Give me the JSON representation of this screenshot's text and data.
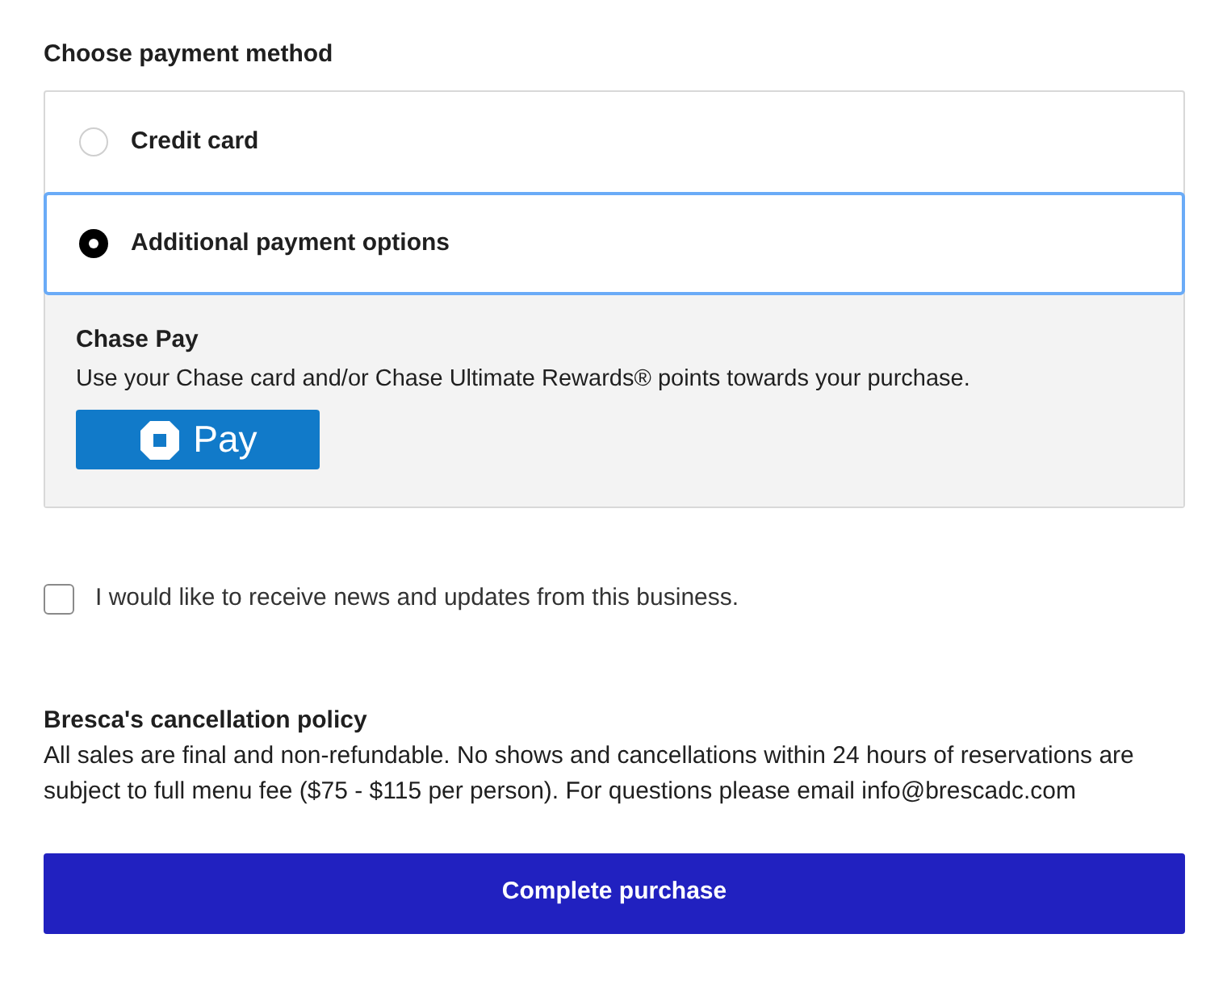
{
  "heading": "Choose payment method",
  "options": [
    {
      "label": "Credit card",
      "selected": false
    },
    {
      "label": "Additional payment options",
      "selected": true
    }
  ],
  "panel": {
    "title": "Chase Pay",
    "description": "Use your Chase card and/or Chase Ultimate Rewards® points towards your purchase.",
    "button": "Pay"
  },
  "newsletter": {
    "label": "I would like to receive news and updates from this business.",
    "checked": false
  },
  "policy": {
    "title": "Bresca's cancellation policy",
    "text": "All sales are final and non-refundable. No shows and cancellations within 24 hours of reservations are subject to full menu fee ($75 - $115 per person). For questions please email info@brescadc.com"
  },
  "submit": "Complete purchase"
}
